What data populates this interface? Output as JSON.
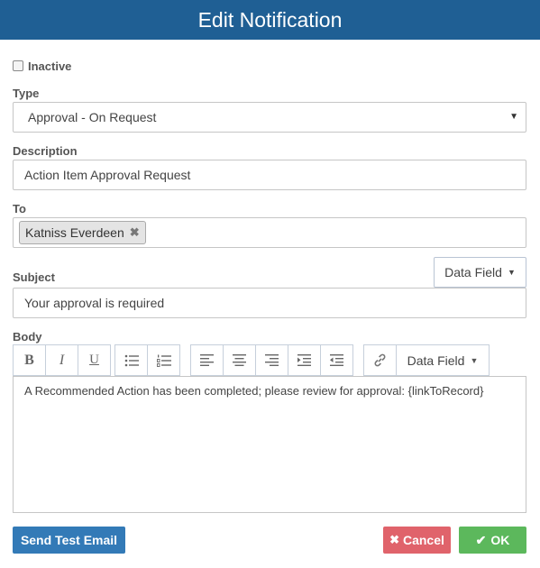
{
  "dialog": {
    "title": "Edit Notification"
  },
  "form": {
    "inactive": {
      "label": "Inactive",
      "checked": false
    },
    "type": {
      "label": "Type",
      "value": "Approval - On Request"
    },
    "description": {
      "label": "Description",
      "value": "Action Item Approval Request"
    },
    "to": {
      "label": "To",
      "recipients": [
        "Katniss Everdeen"
      ],
      "remove_glyph": "✖"
    },
    "subject": {
      "label": "Subject",
      "value": "Your approval is required",
      "data_field_label": "Data Field"
    },
    "body": {
      "label": "Body",
      "data_field_label": "Data Field",
      "text": "A Recommended Action has been completed; please review for approval: {linkToRecord}",
      "toolbar_icons": [
        "bold-icon",
        "italic-icon",
        "underline-icon",
        "bullet-list-icon",
        "numbered-list-icon",
        "align-left-icon",
        "align-center-icon",
        "align-right-icon",
        "indent-icon",
        "outdent-icon",
        "link-icon"
      ]
    }
  },
  "footer": {
    "send_test_label": "Send Test Email",
    "cancel_label": "Cancel",
    "ok_label": "OK"
  },
  "colors": {
    "header": "#1f5f94",
    "primary": "#337ab7",
    "danger": "#e0636b",
    "success": "#5cb85c"
  }
}
